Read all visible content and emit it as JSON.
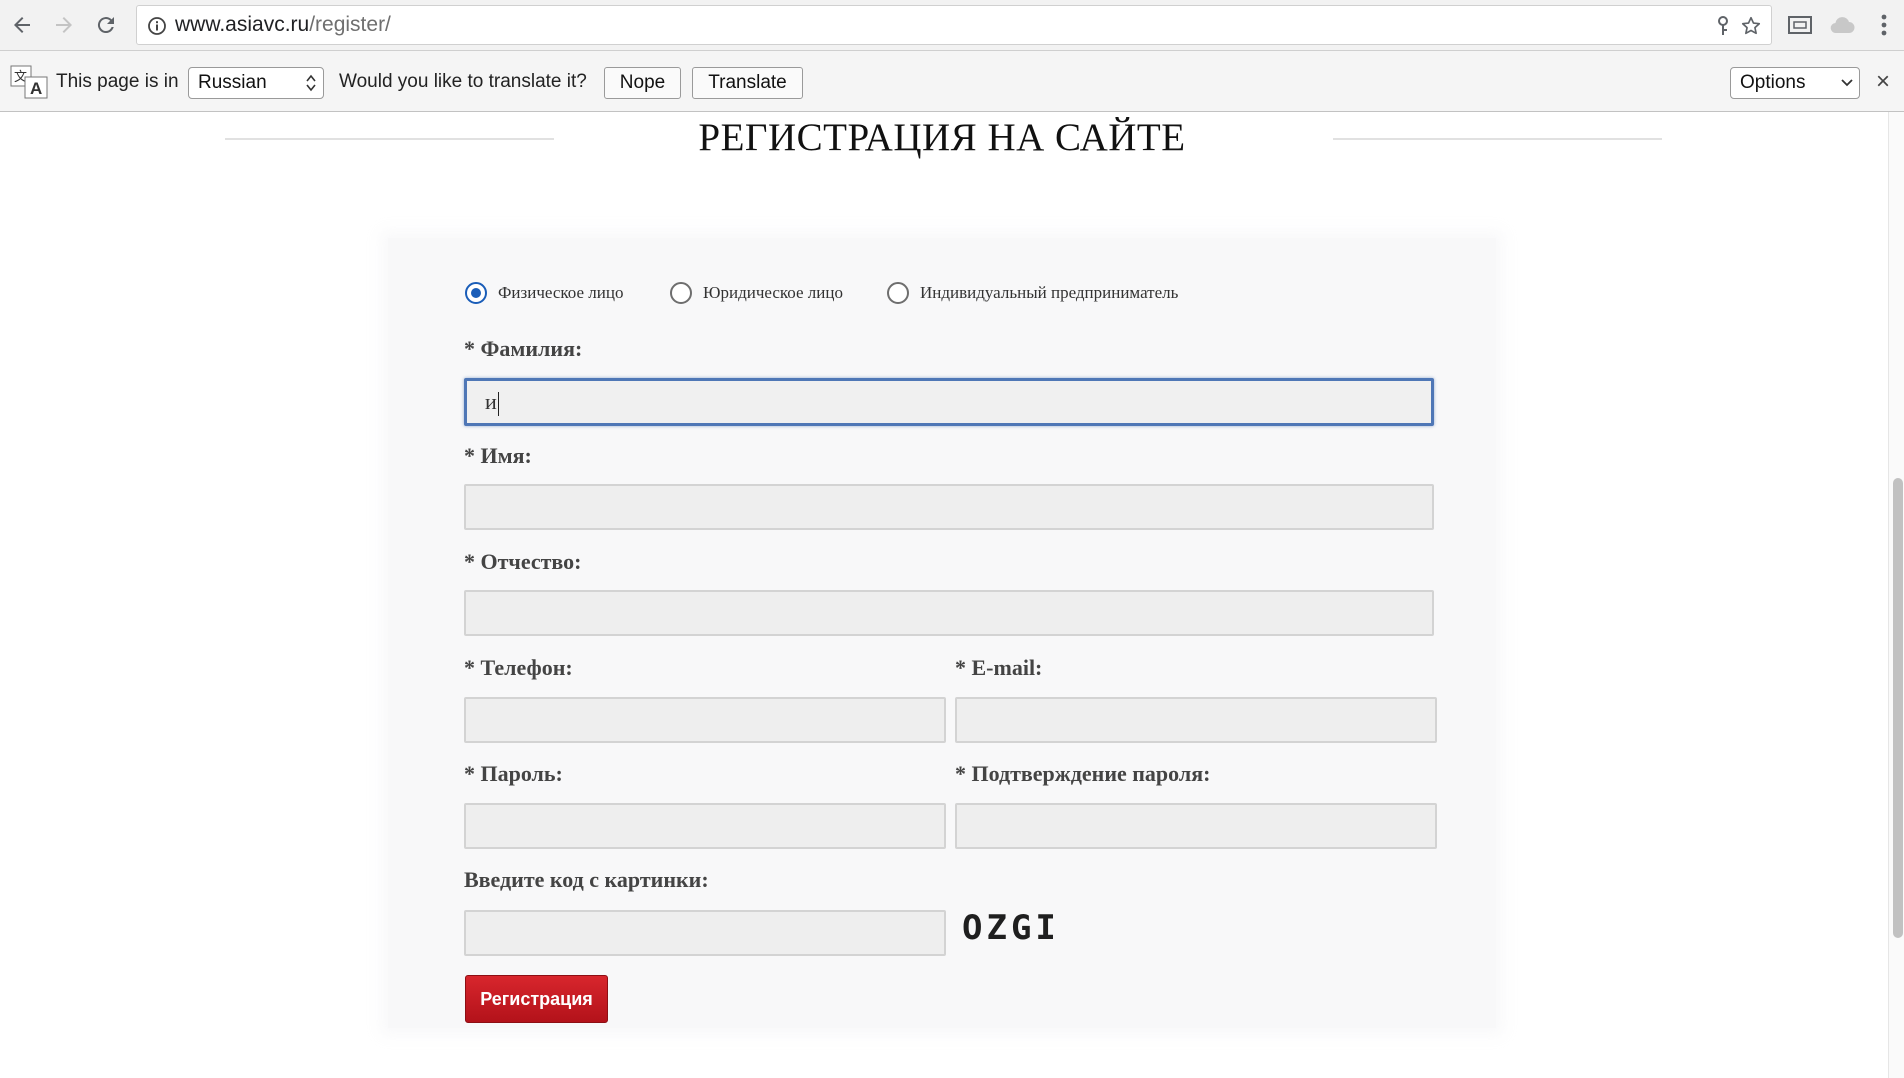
{
  "browser": {
    "url_host": "www.asiavc.ru",
    "url_path": "/register/"
  },
  "translate_bar": {
    "page_is_in": "This page is in",
    "language": "Russian",
    "question": "Would you like to translate it?",
    "nope_label": "Nope",
    "translate_label": "Translate",
    "options_label": "Options",
    "close_glyph": "×"
  },
  "page": {
    "title": "РЕГИСТРАЦИЯ НА САЙТЕ"
  },
  "form": {
    "person_types": [
      {
        "label": "Физическое лицо",
        "checked": true
      },
      {
        "label": "Юридическое лицо",
        "checked": false
      },
      {
        "label": "Индивидуальный предприниматель",
        "checked": false
      }
    ],
    "surname_label": "* Фамилия:",
    "surname_value": "и",
    "name_label": "* Имя:",
    "patronymic_label": "* Отчество:",
    "phone_label": "* Телефон:",
    "email_label": "* E-mail:",
    "password_label": "* Пароль:",
    "password_confirm_label": "* Подтверждение пароля:",
    "captcha_label": "Введите код с картинки:",
    "captcha_code": "OZGI",
    "submit_label": "Регистрация"
  }
}
